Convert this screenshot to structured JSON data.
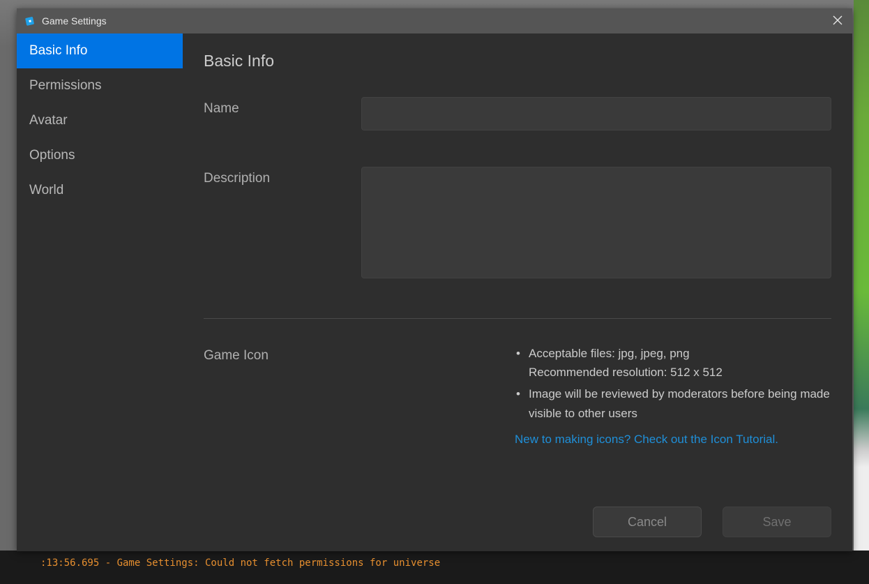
{
  "titlebar": {
    "title": "Game Settings"
  },
  "sidebar": {
    "items": [
      {
        "label": "Basic Info",
        "active": true
      },
      {
        "label": "Permissions",
        "active": false
      },
      {
        "label": "Avatar",
        "active": false
      },
      {
        "label": "Options",
        "active": false
      },
      {
        "label": "World",
        "active": false
      }
    ]
  },
  "content": {
    "title": "Basic Info",
    "name_label": "Name",
    "name_value": "",
    "description_label": "Description",
    "description_value": "",
    "game_icon_label": "Game Icon",
    "game_icon_info1_line1": "Acceptable files: jpg, jpeg, png",
    "game_icon_info1_line2": "Recommended resolution: 512 x 512",
    "game_icon_info2": "Image will be reviewed by moderators before being made visible to other users",
    "tutorial_link": "New to making icons? Check out the Icon Tutorial."
  },
  "footer": {
    "cancel_label": "Cancel",
    "save_label": "Save"
  },
  "console": {
    "line": ":13:56.695 - Game Settings: Could not fetch permissions for universe"
  }
}
